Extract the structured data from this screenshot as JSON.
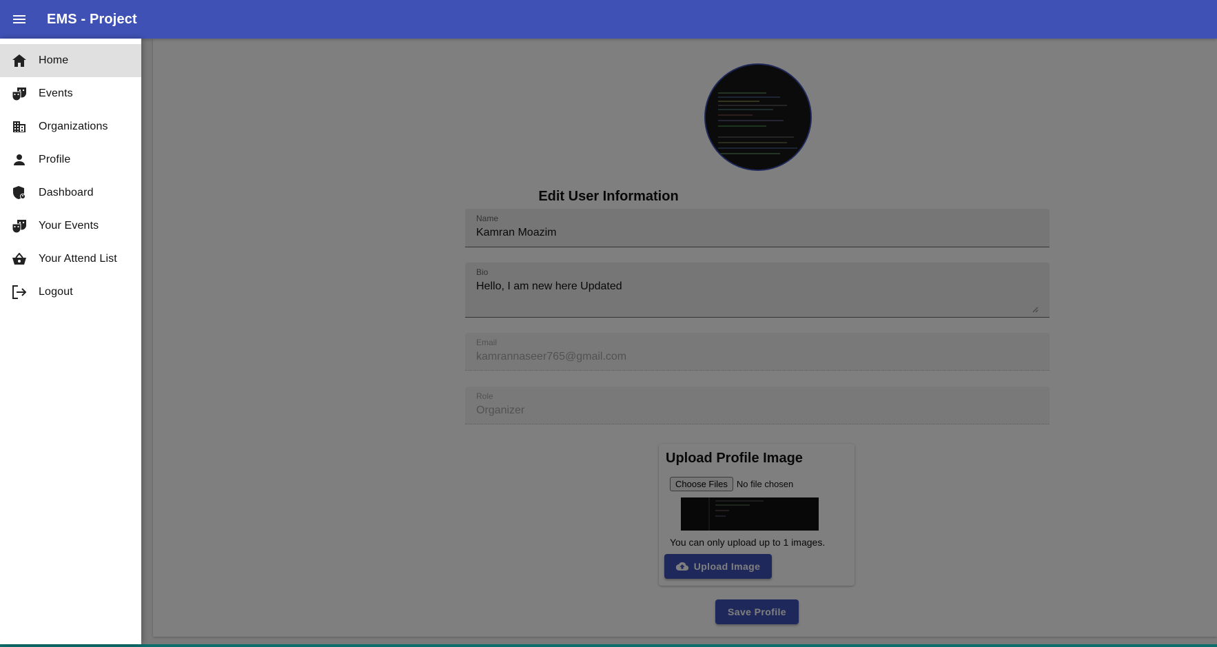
{
  "app": {
    "title": "EMS - Project"
  },
  "sidebar": {
    "items": [
      {
        "label": "Home",
        "icon": "home-icon"
      },
      {
        "label": "Events",
        "icon": "theater-masks-icon"
      },
      {
        "label": "Organizations",
        "icon": "building-icon"
      },
      {
        "label": "Profile",
        "icon": "person-icon"
      },
      {
        "label": "Dashboard",
        "icon": "admin-shield-icon"
      },
      {
        "label": "Your Events",
        "icon": "theater-masks-icon"
      },
      {
        "label": "Your Attend List",
        "icon": "basket-icon"
      },
      {
        "label": "Logout",
        "icon": "logout-icon"
      }
    ],
    "active": "Home"
  },
  "form": {
    "title": "Edit User Information",
    "name": {
      "label": "Name",
      "value": "Kamran Moazim"
    },
    "bio": {
      "label": "Bio",
      "value": "Hello, I am new here Updated"
    },
    "email": {
      "label": "Email",
      "value": "kamrannaseer765@gmail.com"
    },
    "role": {
      "label": "Role",
      "value": "Organizer"
    }
  },
  "upload": {
    "title": "Upload Profile Image",
    "choose_label": "Choose Files",
    "file_status": "No file chosen",
    "limit_text": "You can only upload up to 1 images.",
    "button_label": "Upload Image"
  },
  "save_label": "Save Profile",
  "colors": {
    "primary": "#3f51b5",
    "backdrop": "rgba(0,0,0,0.5)"
  }
}
